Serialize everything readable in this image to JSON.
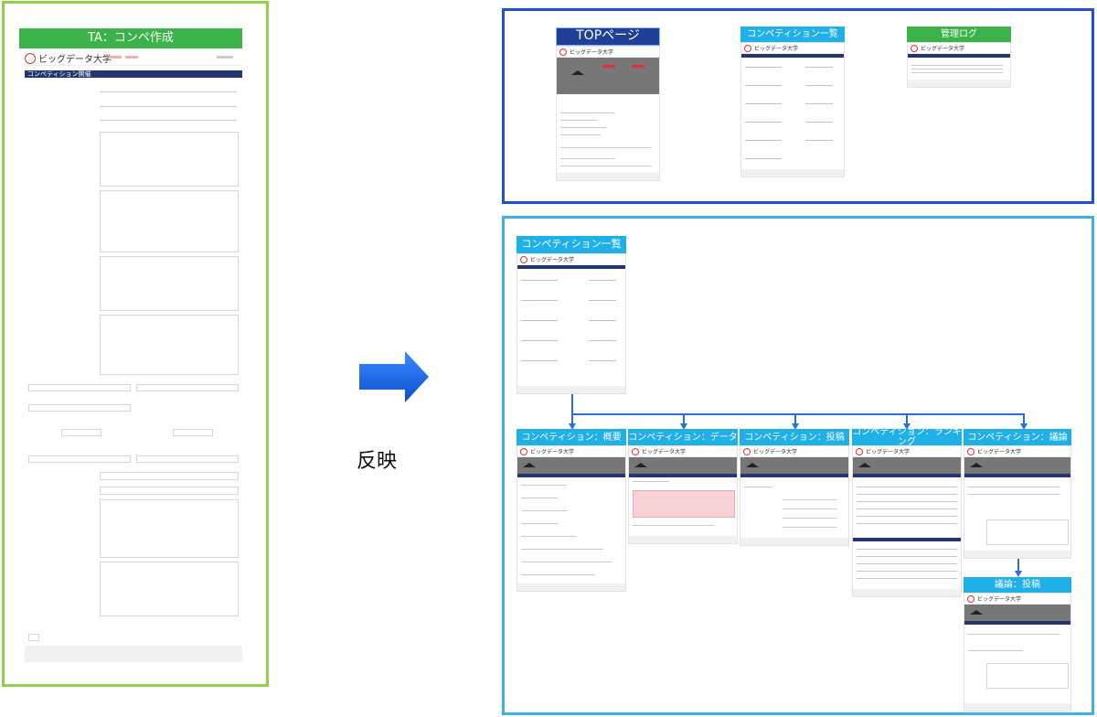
{
  "left_panel": {
    "label": "TA：コンペ作成",
    "university": "ビッグデータ大学",
    "section": "コンペティション開催"
  },
  "middle": {
    "reflect_label": "反映"
  },
  "top_group": {
    "items": [
      {
        "label": "TOPページ"
      },
      {
        "label": "コンペティション一覧"
      },
      {
        "label": "管理ログ"
      }
    ]
  },
  "bottom_group": {
    "root_label": "コンペティション一覧",
    "children": [
      {
        "label": "コンペティション：概要"
      },
      {
        "label": "コンペティション：データ"
      },
      {
        "label": "コンペティション：投稿"
      },
      {
        "label": "コンペティション：ランキング"
      },
      {
        "label": "コンペティション：議論"
      }
    ],
    "sub_child": {
      "label": "議論：投稿"
    }
  },
  "colors": {
    "green_frame": "#92d050",
    "blue_frame": "#1f4fd6",
    "cyan_frame": "#41b0e8",
    "arrow": "#1f6fe0"
  }
}
